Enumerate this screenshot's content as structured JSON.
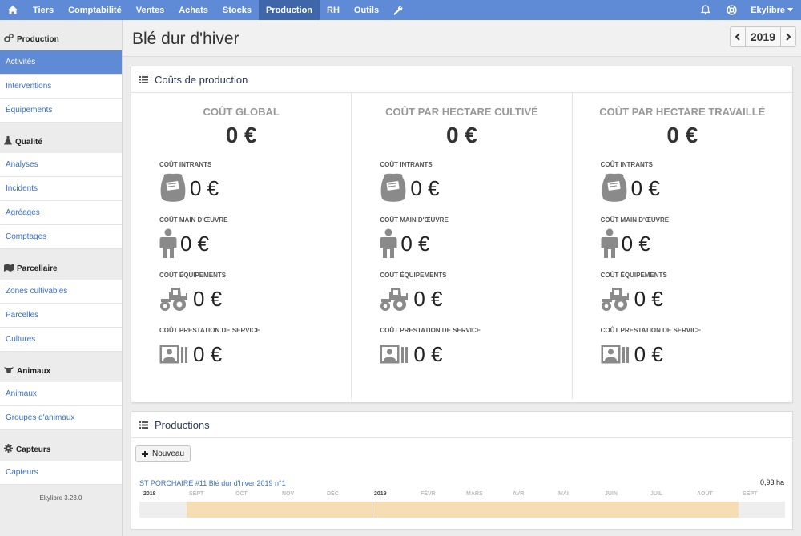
{
  "topbar": {
    "items": [
      "Tiers",
      "Comptabilité",
      "Ventes",
      "Achats",
      "Stocks",
      "Production",
      "RH",
      "Outils"
    ],
    "active": "Production",
    "user": "Ekylibre",
    "colors": {
      "bar": "#5f8ad6",
      "active": "#3f66a8"
    }
  },
  "sidebar": {
    "sections": [
      {
        "title": "Production",
        "icon": "gears-icon",
        "items": [
          "Activités",
          "Interventions",
          "Équipements"
        ]
      },
      {
        "title": "Qualité",
        "icon": "flask-icon",
        "items": [
          "Analyses",
          "Incidents",
          "Agréages",
          "Comptages"
        ]
      },
      {
        "title": "Parcellaire",
        "icon": "map-icon",
        "items": [
          "Zones cultivables",
          "Parcelles",
          "Cultures"
        ]
      },
      {
        "title": "Animaux",
        "icon": "cow-icon",
        "items": [
          "Animaux",
          "Groupes d'animaux"
        ]
      },
      {
        "title": "Capteurs",
        "icon": "gear-icon",
        "items": [
          "Capteurs"
        ]
      }
    ],
    "active_item": "Activités",
    "version": "Ekylibre 3.23.0"
  },
  "page": {
    "title": "Blé dur d'hiver",
    "year": "2019"
  },
  "costs": {
    "panel_title": "Coûts de production",
    "columns": [
      {
        "title": "COÛT GLOBAL",
        "total": "0 €"
      },
      {
        "title": "COÛT PAR HECTARE CULTIVÉ",
        "total": "0 €"
      },
      {
        "title": "COÛT PAR HECTARE TRAVAILLÉ",
        "total": "0 €"
      }
    ],
    "sub_costs": [
      {
        "label": "COÛT INTRANTS",
        "value": "0 €",
        "icon": "seed-bag-icon"
      },
      {
        "label": "COÛT MAIN D'ŒUVRE",
        "value": "0 €",
        "icon": "person-icon"
      },
      {
        "label": "COÛT ÉQUIPEMENTS",
        "value": "0 €",
        "icon": "tractor-icon"
      },
      {
        "label": "COÛT PRESTATION DE SERVICE",
        "value": "0 €",
        "icon": "contact-card-icon"
      }
    ]
  },
  "productions": {
    "panel_title": "Productions",
    "new_button": "Nouveau",
    "item": {
      "name": "ST PORCHAIRE #11 Blé dur d'hiver 2019 n°1",
      "area": "0,93 ha"
    },
    "timeline": {
      "labels": [
        {
          "text": "2018",
          "year": true
        },
        {
          "text": "SEPT",
          "year": false
        },
        {
          "text": "OCT",
          "year": false
        },
        {
          "text": "NOV",
          "year": false
        },
        {
          "text": "DÉC",
          "year": false
        },
        {
          "text": "2019",
          "year": true
        },
        {
          "text": "FÉVR",
          "year": false
        },
        {
          "text": "MARS",
          "year": false
        },
        {
          "text": "AVR",
          "year": false
        },
        {
          "text": "MAI",
          "year": false
        },
        {
          "text": "JUIN",
          "year": false
        },
        {
          "text": "JUIL",
          "year": false
        },
        {
          "text": "AOÛT",
          "year": false
        },
        {
          "text": "SEPT",
          "year": false
        }
      ],
      "fill_color": "#f7ddb4"
    }
  }
}
